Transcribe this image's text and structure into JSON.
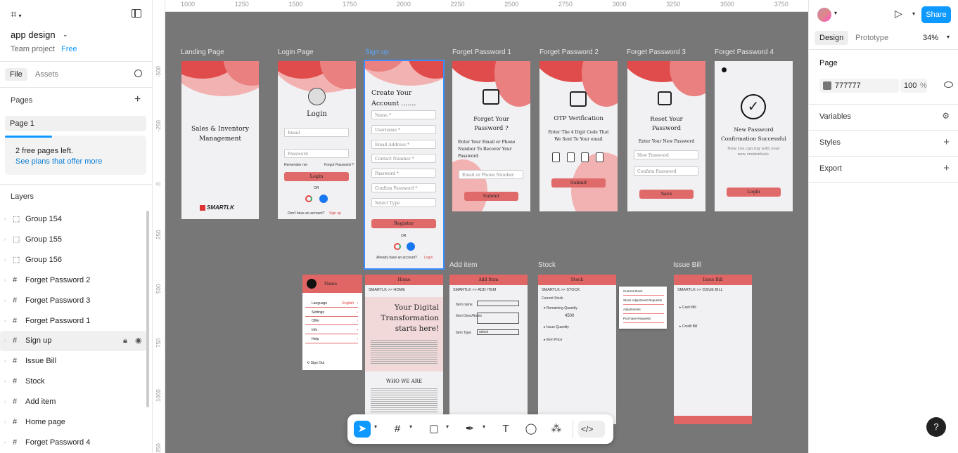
{
  "left": {
    "file_name": "app design",
    "team": "Team project",
    "plan": "Free",
    "tabs": [
      "File",
      "Assets"
    ],
    "pages_title": "Pages",
    "page_item": "Page 1",
    "notice_text": "2 free pages left.",
    "notice_link": "See plans that offer more",
    "layers_title": "Layers",
    "layers": [
      {
        "name": "Group 154",
        "type": "group"
      },
      {
        "name": "Group 155",
        "type": "group"
      },
      {
        "name": "Group 156",
        "type": "group"
      },
      {
        "name": "Forget Password 2",
        "type": "frame"
      },
      {
        "name": "Forget Password 3",
        "type": "frame"
      },
      {
        "name": "Forget Password 1",
        "type": "frame"
      },
      {
        "name": "Sign up",
        "type": "frame"
      },
      {
        "name": "Issue Bill",
        "type": "frame"
      },
      {
        "name": "Stock",
        "type": "frame"
      },
      {
        "name": "Add item",
        "type": "frame"
      },
      {
        "name": "Home page",
        "type": "frame"
      },
      {
        "name": "Forget Password 4",
        "type": "frame"
      }
    ]
  },
  "right": {
    "share": "Share",
    "tabs": [
      "Design",
      "Prototype"
    ],
    "zoom": "34%",
    "page_title": "Page",
    "page_color": "777777",
    "page_opacity": "100",
    "percent": "%",
    "sections": [
      "Variables",
      "Styles",
      "Export"
    ],
    "colors": {
      "accent": "#0d99ff",
      "canvas": "#777777"
    }
  },
  "ruler": {
    "x": [
      "1000",
      "1250",
      "1500",
      "1750",
      "2000",
      "2250",
      "2500",
      "2750",
      "3000",
      "3250",
      "3500",
      "3750"
    ],
    "y": [
      "-500",
      "-250",
      "0",
      "250",
      "500",
      "750",
      "1000",
      "1250"
    ]
  },
  "frames": {
    "landing": {
      "label": "Landing Page",
      "title": "Sales & Inventory Management",
      "logo": "SMARTLK"
    },
    "login": {
      "label": "Login Page",
      "title": "Login",
      "email": "Email",
      "password": "Password",
      "remember": "Remember me",
      "forgot": "Forgot Password ?",
      "button": "Login",
      "or": "OR",
      "no_account": "Don't have an account?",
      "signup": "Sign up"
    },
    "signup": {
      "label": "Sign up",
      "title": "Create Your Account .......",
      "fields": [
        "Name *",
        "Username *",
        "Email Address *",
        "Contact Number *",
        "Password *",
        "Confirm Password *",
        "Select Type"
      ],
      "button": "Register",
      "or": "OR",
      "have_account": "Already have an account?",
      "login": "Login"
    },
    "fp1": {
      "label": "Forget Password 1",
      "title": "Forget Your Password ?",
      "desc": "Enter Your Email or Phone Number To Recover Your Password",
      "input": "Email or Phone Number",
      "button": "Submit"
    },
    "fp2": {
      "label": "Forget Password 2",
      "title": "OTP Verification",
      "desc": "Enter The 4 Digit Code That We Sent To Your email",
      "button": "Submit"
    },
    "fp3": {
      "label": "Forget Password 3",
      "title": "Reset Your Password",
      "desc": "Enter Your New Password",
      "new": "New Password",
      "confirm": "Confirm Password",
      "button": "Save"
    },
    "fp4": {
      "label": "Forget Password 4",
      "title": "New Password Confirmation Successful",
      "desc": "Now you can log with your new credentials.",
      "button": "Login"
    },
    "menu": {
      "name": "Name",
      "items": [
        "Language",
        "Settings",
        "Offer",
        "Info",
        "Help"
      ],
      "lang_value": "English",
      "signout": "Sign Out"
    },
    "home": {
      "header": "Home",
      "crumb": "SMARTLK >> HOME",
      "hero": "Your Digital Transformation starts here!",
      "who": "WHO WE ARE"
    },
    "additem": {
      "label": "Add item",
      "header": "Add Item",
      "crumb": "SMARTLK >> ADD ITEM",
      "fields": [
        "Item name",
        "Item Desc/Notes",
        "Item Type"
      ],
      "select": "select"
    },
    "stock": {
      "label": "Stock",
      "header": "Stock",
      "crumb": "SMARTLK >> STOCK",
      "sub": "Current Stock",
      "rows": [
        "Remaining Quantity",
        "Issue Quantity",
        "Item Price"
      ],
      "value": "4500",
      "popup": [
        "Current Stock",
        "Stock Adjustment Requests",
        "Adjustments",
        "Purchase Requests"
      ]
    },
    "issue": {
      "label": "Issue Bill",
      "header": "Issue Bill",
      "crumb": "SMARTLK >> ISSUE BILL",
      "rows": [
        "Cash Bill",
        "Credit Bill"
      ]
    }
  }
}
